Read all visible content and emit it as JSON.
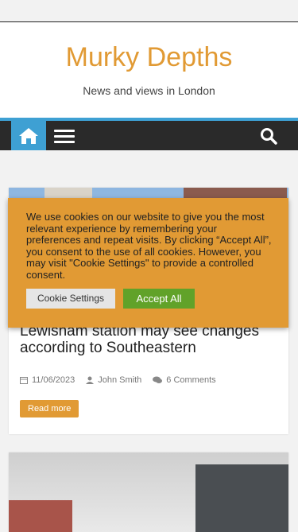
{
  "header": {
    "site_title": "Murky Depths",
    "site_description": "News and views in London"
  },
  "nav": {
    "home_icon": "home-icon",
    "menu_icon": "menu-icon",
    "search_icon": "search-icon"
  },
  "posts": [
    {
      "title": "Lewisham station may see changes according to Southeastern",
      "date": "11/06/2023",
      "author": "John Smith",
      "comments": "6 Comments",
      "read_more": "Read more"
    }
  ],
  "cookie_banner": {
    "text": "We use cookies on our website to give you the most relevant experience by remembering your preferences and repeat visits. By clicking “Accept All”, you consent to the use of all cookies. However, you may visit \"Cookie Settings\" to provide a controlled consent.",
    "settings_label": "Cookie Settings",
    "accept_label": "Accept All"
  },
  "colors": {
    "accent": "#e19a34",
    "nav_blue": "#3ea0d3",
    "nav_dark": "#2a2a2a",
    "accept_green": "#61a229"
  }
}
